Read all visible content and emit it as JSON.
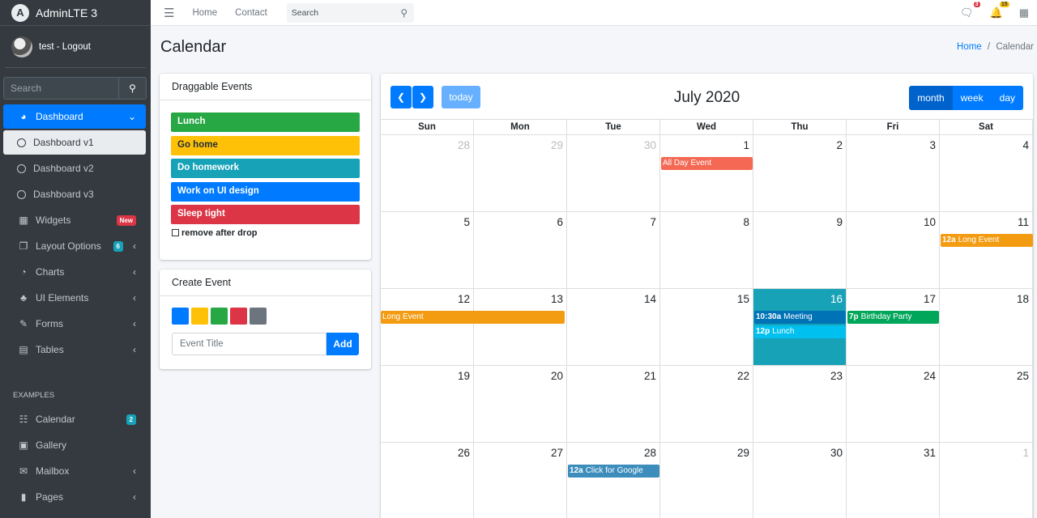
{
  "brand": {
    "name": "AdminLTE 3",
    "logo_letter": "A"
  },
  "user": {
    "name": "test - Logout"
  },
  "sidebar_search": {
    "placeholder": "Search"
  },
  "nav": [
    {
      "label": "Dashboard",
      "icon": "tachometer-icon",
      "active": true,
      "arrow": "chevron-down-icon"
    },
    {
      "label": "Dashboard v1",
      "sub": true,
      "sub_active": true
    },
    {
      "label": "Dashboard v2",
      "sub": true
    },
    {
      "label": "Dashboard v3",
      "sub": true
    },
    {
      "label": "Widgets",
      "icon": "th-icon",
      "badge": "New",
      "badge_color": "#dc3545"
    },
    {
      "label": "Layout Options",
      "icon": "copy-icon",
      "badge": "6",
      "badge_color": "#17a2b8",
      "arrow": "chevron-left-icon"
    },
    {
      "label": "Charts",
      "icon": "pie-chart-icon",
      "arrow": "chevron-left-icon"
    },
    {
      "label": "UI Elements",
      "icon": "tree-icon",
      "arrow": "chevron-left-icon"
    },
    {
      "label": "Forms",
      "icon": "edit-icon",
      "arrow": "chevron-left-icon"
    },
    {
      "label": "Tables",
      "icon": "table-icon",
      "arrow": "chevron-left-icon"
    }
  ],
  "examples_header": "EXAMPLES",
  "examples": [
    {
      "label": "Calendar",
      "icon": "calendar-icon",
      "badge": "2",
      "badge_color": "#17a2b8"
    },
    {
      "label": "Gallery",
      "icon": "image-icon"
    },
    {
      "label": "Mailbox",
      "icon": "envelope-icon",
      "arrow": "chevron-left-icon"
    },
    {
      "label": "Pages",
      "icon": "book-icon",
      "arrow": "chevron-left-icon"
    }
  ],
  "topbar": {
    "home": "Home",
    "contact": "Contact",
    "search_placeholder": "Search",
    "messages_count": "3",
    "notifications_count": "15"
  },
  "page": {
    "title": "Calendar",
    "breadcrumb_home": "Home",
    "breadcrumb_sep": "/",
    "breadcrumb_current": "Calendar"
  },
  "draggable": {
    "title": "Draggable Events",
    "events": [
      {
        "label": "Lunch",
        "color": "#28a745"
      },
      {
        "label": "Go home",
        "color": "#ffc107",
        "text": "#1f2d3d"
      },
      {
        "label": "Do homework",
        "color": "#17a2b8"
      },
      {
        "label": "Work on UI design",
        "color": "#007bff"
      },
      {
        "label": "Sleep tight",
        "color": "#dc3545"
      }
    ],
    "remove_label": "remove after drop"
  },
  "create_event": {
    "title": "Create Event",
    "colors": [
      "#007bff",
      "#ffc107",
      "#28a745",
      "#dc3545",
      "#6c757d"
    ],
    "placeholder": "Event Title",
    "add_label": "Add"
  },
  "calendar": {
    "title": "July 2020",
    "today_label": "today",
    "views": [
      "month",
      "week",
      "day"
    ],
    "active_view": "month",
    "dow": [
      "Sun",
      "Mon",
      "Tue",
      "Wed",
      "Thu",
      "Fri",
      "Sat"
    ],
    "weeks": [
      [
        {
          "d": "28",
          "o": true
        },
        {
          "d": "29",
          "o": true
        },
        {
          "d": "30",
          "o": true
        },
        {
          "d": "1"
        },
        {
          "d": "2"
        },
        {
          "d": "3"
        },
        {
          "d": "4"
        }
      ],
      [
        {
          "d": "5"
        },
        {
          "d": "6"
        },
        {
          "d": "7"
        },
        {
          "d": "8"
        },
        {
          "d": "9"
        },
        {
          "d": "10"
        },
        {
          "d": "11"
        }
      ],
      [
        {
          "d": "12"
        },
        {
          "d": "13"
        },
        {
          "d": "14"
        },
        {
          "d": "15"
        },
        {
          "d": "16",
          "t": true
        },
        {
          "d": "17"
        },
        {
          "d": "18"
        }
      ],
      [
        {
          "d": "19"
        },
        {
          "d": "20"
        },
        {
          "d": "21"
        },
        {
          "d": "22"
        },
        {
          "d": "23"
        },
        {
          "d": "24"
        },
        {
          "d": "25"
        }
      ],
      [
        {
          "d": "26"
        },
        {
          "d": "27"
        },
        {
          "d": "28"
        },
        {
          "d": "29"
        },
        {
          "d": "30"
        },
        {
          "d": "31"
        },
        {
          "d": "1",
          "o": true
        }
      ]
    ],
    "events": [
      {
        "week": 0,
        "start": 3,
        "span": 1,
        "row": 0,
        "time": "",
        "title": "All Day Event",
        "color": "#f56954"
      },
      {
        "week": 1,
        "start": 6,
        "span": 1,
        "row": 1,
        "time": "12a",
        "title": "Long Event",
        "color": "#f39c12",
        "open_right": true
      },
      {
        "week": 2,
        "start": 0,
        "span": 2,
        "row": 1,
        "time": "",
        "title": "Long Event",
        "color": "#f39c12",
        "open_left": true
      },
      {
        "week": 2,
        "start": 4,
        "span": 1,
        "row": 1,
        "time": "10:30a",
        "title": "Meeting",
        "color": "#0073b7"
      },
      {
        "week": 2,
        "start": 4,
        "span": 1,
        "row": 2,
        "time": "12p",
        "title": "Lunch",
        "color": "#00c0ef"
      },
      {
        "week": 2,
        "start": 5,
        "span": 1,
        "row": 1,
        "time": "7p",
        "title": "Birthday Party",
        "color": "#00a65a"
      },
      {
        "week": 4,
        "start": 2,
        "span": 1,
        "row": 1,
        "time": "12a",
        "title": "Click for Google",
        "color": "#3c8dbc"
      }
    ]
  }
}
